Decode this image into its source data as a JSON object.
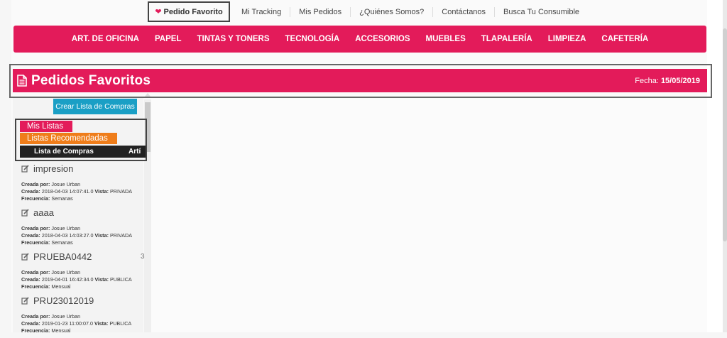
{
  "top_nav": {
    "items": [
      {
        "label": "Pedido Favorito",
        "active": true
      },
      {
        "label": "Mi Tracking"
      },
      {
        "label": "Mis Pedidos"
      },
      {
        "label": "¿Quiénes Somos?"
      },
      {
        "label": "Contáctanos"
      },
      {
        "label": "Busca Tu Consumible"
      }
    ]
  },
  "categories": [
    "ART. DE OFICINA",
    "PAPEL",
    "TINTAS Y TONERS",
    "TECNOLOGÍA",
    "ACCESORIOS",
    "MUEBLES",
    "TLAPALERÍA",
    "LIMPIEZA",
    "CAFETERÍA"
  ],
  "header": {
    "title": "Pedidos Favoritos",
    "date_label": "Fecha:",
    "date_value": "15/05/2019"
  },
  "sidebar": {
    "create_button": "Crear Lista de Compras",
    "tabs": {
      "mine": "Mis Listas",
      "recommended": "Listas Recomendadas"
    },
    "columns": [
      "Lista de Compras",
      "Artí"
    ],
    "labels": {
      "created_by": "Creada por:",
      "created": "Creada:",
      "visibility": "Vista:",
      "frequency": "Frecuencia:"
    },
    "lists": [
      {
        "name": "impresion",
        "created_by": "Josue Urban",
        "created": "2018-04-03 14:07:41.0",
        "visibility": "PRIVADA",
        "frequency": "Semanas",
        "side": ""
      },
      {
        "name": "aaaa",
        "created_by": "Josue Urban",
        "created": "2018-04-03 14:03:27.0",
        "visibility": "PRIVADA",
        "frequency": "Semanas",
        "side": ""
      },
      {
        "name": "PRUEBA0442",
        "created_by": "Josue Urban",
        "created": "2019-04-01 16:42:34.0",
        "visibility": "PUBLICA",
        "frequency": "Mensual",
        "side": "3"
      },
      {
        "name": "PRU23012019",
        "created_by": "Josue Urban",
        "created": "2019-01-23 11:00:07.0",
        "visibility": "PUBLICA",
        "frequency": "Mensual",
        "side": ""
      }
    ]
  },
  "colors": {
    "brand": "#e31b5a",
    "orange": "#ef7d1a",
    "blue": "#1a9fc5"
  },
  "icons": {
    "favorite": "heart-icon",
    "header": "document-icon",
    "list_item": "edit-icon"
  }
}
